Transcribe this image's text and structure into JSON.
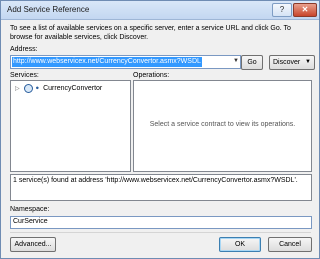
{
  "window": {
    "title": "Add Service Reference",
    "help_label": "?",
    "close_label": "✕"
  },
  "instructions": "To see a list of available services on a specific server, enter a service URL and click Go. To browse for available services, click Discover.",
  "address": {
    "label": "Address:",
    "value": "http://www.webservicex.net/CurrencyConvertor.asmx?WSDL"
  },
  "buttons": {
    "go": "Go",
    "discover": "Discover",
    "advanced": "Advanced...",
    "ok": "OK",
    "cancel": "Cancel"
  },
  "services": {
    "label": "Services:",
    "items": [
      {
        "name": "CurrencyConvertor"
      }
    ]
  },
  "operations": {
    "label": "Operations:",
    "placeholder": "Select a service contract to view its operations."
  },
  "status": "1 service(s) found at address 'http://www.webservicex.net/CurrencyConvertor.asmx?WSDL'.",
  "namespace": {
    "label": "Namespace:",
    "value": "CurService"
  }
}
